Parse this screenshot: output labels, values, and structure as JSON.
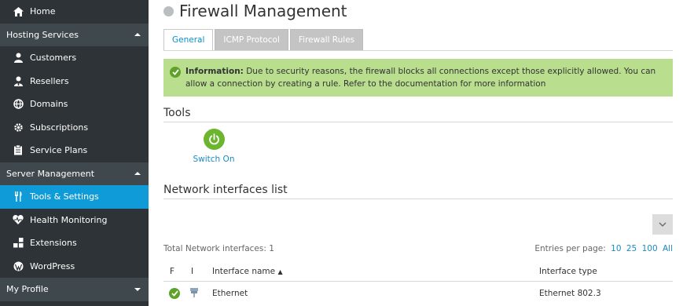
{
  "sidebar": {
    "home": {
      "label": "Home",
      "icon": "home-icon"
    },
    "sections": [
      {
        "label": "Hosting Services",
        "items": [
          {
            "label": "Customers",
            "icon": "customer-icon"
          },
          {
            "label": "Resellers",
            "icon": "reseller-icon"
          },
          {
            "label": "Domains",
            "icon": "globe-icon"
          },
          {
            "label": "Subscriptions",
            "icon": "gear-icon"
          },
          {
            "label": "Service Plans",
            "icon": "clipboard-icon"
          }
        ]
      },
      {
        "label": "Server Management",
        "items": [
          {
            "label": "Tools & Settings",
            "icon": "tools-icon",
            "active": true
          },
          {
            "label": "Health Monitoring",
            "icon": "heart-icon"
          },
          {
            "label": "Extensions",
            "icon": "extensions-icon"
          },
          {
            "label": "WordPress",
            "icon": "wordpress-icon"
          }
        ]
      },
      {
        "label": "My Profile"
      }
    ]
  },
  "main": {
    "title": "Firewall Management",
    "tabs": [
      {
        "label": "General",
        "active": true
      },
      {
        "label": "ICMP Protocol"
      },
      {
        "label": "Firewall Rules"
      }
    ],
    "info": {
      "strong": "Information:",
      "text": " Due to security reasons, the firewall blocks all connections except those explicitly allowed. You can allow a connection by creating a rule. Refer to the documentation for more information"
    },
    "tools": {
      "heading": "Tools",
      "switch_on": "Switch On"
    },
    "network": {
      "heading": "Network interfaces list",
      "total": "Total Network interfaces: 1",
      "entries_label": "Entries per page:",
      "entries_options": [
        "10",
        "25",
        "100",
        "All"
      ],
      "columns": {
        "f": "F",
        "i": "I",
        "name": "Interface name",
        "sort_arrow": "▲",
        "type": "Interface type"
      },
      "rows": [
        {
          "name": "Ethernet",
          "type": "Ethernet 802.3"
        }
      ]
    }
  },
  "colors": {
    "sidebar_bg": "#2d3336",
    "section_bg": "#3f484c",
    "active_bg": "#0e9bd8",
    "info_bg": "#b8de8e",
    "success": "#5fa22a",
    "link": "#1a8ac4"
  }
}
